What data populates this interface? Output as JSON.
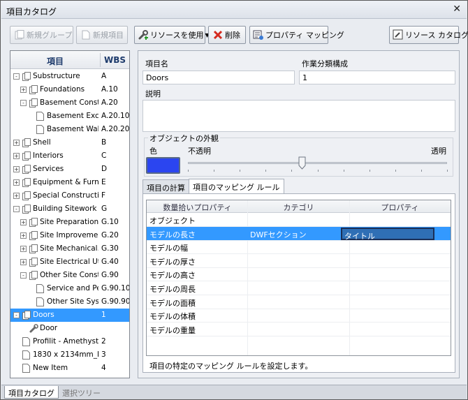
{
  "window": {
    "title": "項目カタログ",
    "close": "✕"
  },
  "toolbar": {
    "new_group": "新規グループ",
    "new_item": "新規項目",
    "use_resource": "リソースを使用",
    "delete": "削除",
    "property_mapping": "プロパティ マッピング",
    "resource_catalog": "リソース カタログ"
  },
  "tree": {
    "header_item": "項目",
    "header_wbs": "WBS",
    "rows": [
      {
        "label": "Substructure",
        "wbs": "A"
      },
      {
        "label": "Foundations",
        "wbs": "A.10"
      },
      {
        "label": "Basement Constr...",
        "wbs": "A.20"
      },
      {
        "label": "Basement Exca...",
        "wbs": "A.20.10"
      },
      {
        "label": "Basement Walls",
        "wbs": "A.20.20"
      },
      {
        "label": "Shell",
        "wbs": "B"
      },
      {
        "label": "Interiors",
        "wbs": "C"
      },
      {
        "label": "Services",
        "wbs": "D"
      },
      {
        "label": "Equipment & Furni...",
        "wbs": "E"
      },
      {
        "label": "Special Constructio...",
        "wbs": "F"
      },
      {
        "label": "Building Sitework",
        "wbs": "G"
      },
      {
        "label": "Site Preparation",
        "wbs": "G.10"
      },
      {
        "label": "Site Improvements",
        "wbs": "G.20"
      },
      {
        "label": "Site Mechanical...",
        "wbs": "G.30"
      },
      {
        "label": "Site Electrical Uti...",
        "wbs": "G.40"
      },
      {
        "label": "Other Site Const...",
        "wbs": "G.90"
      },
      {
        "label": "Service and Pe...",
        "wbs": "G.90.10"
      },
      {
        "label": "Other Site Syst...",
        "wbs": "G.90.90"
      },
      {
        "label": "Doors",
        "wbs": "1"
      },
      {
        "label": "Door",
        "wbs": ""
      },
      {
        "label": "Profilit - Amethyst",
        "wbs": "2"
      },
      {
        "label": "1830 x 2134mm_M...",
        "wbs": "3"
      },
      {
        "label": "New Item",
        "wbs": "4"
      }
    ]
  },
  "details": {
    "name_label": "項目名",
    "name_value": "Doors",
    "wbs_label": "作業分類構成",
    "wbs_value": "1",
    "desc_label": "説明",
    "desc_value": "",
    "appearance_label": "オブジェクトの外観",
    "color_label": "色",
    "opaque_label": "不透明",
    "transparent_label": "透明",
    "color": "#2b45f0",
    "transparency": 0.44
  },
  "tabs": {
    "calc": "項目の計算",
    "mapping": "項目のマッピング ルール"
  },
  "mapping": {
    "headers": [
      "数量拾いプロパティ",
      "カテゴリ",
      "プロパティ"
    ],
    "rows": [
      {
        "prop": "オブジェクト",
        "cat": "",
        "val": ""
      },
      {
        "prop": "モデルの長さ",
        "cat": "DWFセクション",
        "val": "タイトル"
      },
      {
        "prop": "モデルの幅",
        "cat": "",
        "val": ""
      },
      {
        "prop": "モデルの厚さ",
        "cat": "",
        "val": ""
      },
      {
        "prop": "モデルの高さ",
        "cat": "",
        "val": ""
      },
      {
        "prop": "モデルの周長",
        "cat": "",
        "val": ""
      },
      {
        "prop": "モデルの面積",
        "cat": "",
        "val": ""
      },
      {
        "prop": "モデルの体積",
        "cat": "",
        "val": ""
      },
      {
        "prop": "モデルの重量",
        "cat": "",
        "val": ""
      }
    ],
    "hint": "項目の特定のマッピング ルールを設定します。"
  },
  "bottom_tabs": {
    "catalog": "項目カタログ",
    "selection": "選択ツリー"
  }
}
